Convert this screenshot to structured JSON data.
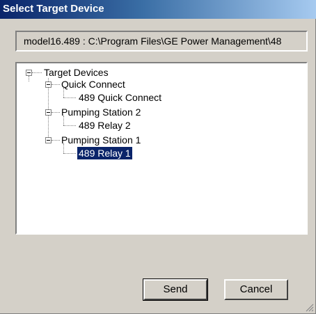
{
  "window": {
    "title": "Select Target Device"
  },
  "path": {
    "value": "model16.489 : C:\\Program Files\\GE Power Management\\48"
  },
  "tree": {
    "root": "Target Devices",
    "groups": [
      {
        "label": "Quick Connect",
        "child": "489 Quick Connect"
      },
      {
        "label": "Pumping Station 2",
        "child": "489 Relay 2"
      },
      {
        "label": "Pumping Station 1",
        "child": "489 Relay 1"
      }
    ],
    "selected": "489 Relay 1"
  },
  "buttons": {
    "send": "Send",
    "cancel": "Cancel"
  }
}
